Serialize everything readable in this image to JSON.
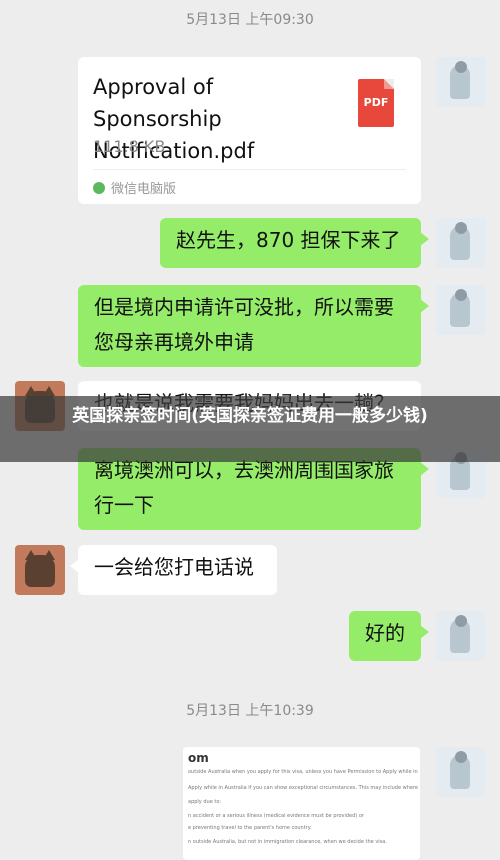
{
  "timestamps": [
    "5月13日 上午09:30",
    "5月13日 上午10:39"
  ],
  "file": {
    "name": "Approval of Sponsorship Notification.pdf",
    "size": "111.8 KB",
    "source": "微信电脑版",
    "type_label": "PDF"
  },
  "messages": [
    {
      "text": "赵先生，870 担保下来了"
    },
    {
      "text": "但是境内申请许可没批，所以需要您母亲再境外申请"
    },
    {
      "text": "也就是说我需要我妈妈出去一趟？"
    },
    {
      "text": "离境澳洲可以，去澳洲周围国家旅行一下"
    },
    {
      "text": "一会给您打电话说"
    },
    {
      "text": "好的"
    }
  ],
  "overlay": {
    "title": "英国探亲签时间(英国探亲签证费用一般多少钱)"
  },
  "doc": {
    "title": "om",
    "lines": [
      "outside Australia when you apply for this visa, unless you have Permission to Apply while in Australia (see",
      "Apply while in Australia if you can show exceptional circumstances. This may include where the parent is unw",
      "apply due to:",
      "n accident or a serious illness (medical evidence must be provided) or",
      "e preventing travel to the parent's home country.",
      "n outside Australia, but not in immigration clearance, when we decide the visa."
    ]
  }
}
